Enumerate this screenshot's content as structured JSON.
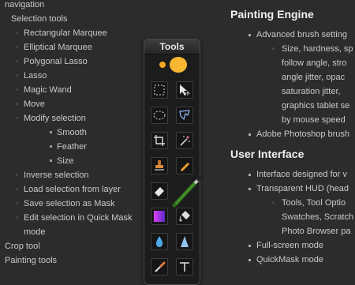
{
  "left_outline": [
    {
      "label": "navigation",
      "level": 0
    },
    {
      "label": "Selection tools",
      "level": 1
    },
    {
      "label": "Rectangular Marquee",
      "level": 2
    },
    {
      "label": "Elliptical Marquee",
      "level": 2
    },
    {
      "label": "Polygonal Lasso",
      "level": 2
    },
    {
      "label": "Lasso",
      "level": 2
    },
    {
      "label": "Magic Wand",
      "level": 2
    },
    {
      "label": "Move",
      "level": 2
    },
    {
      "label": "Modify selection",
      "level": 2
    },
    {
      "label": "Smooth",
      "level": 3
    },
    {
      "label": "Feather",
      "level": 3
    },
    {
      "label": "Size",
      "level": 3
    },
    {
      "label": "Inverse selection",
      "level": 2
    },
    {
      "label": "Load selection from layer",
      "level": 2
    },
    {
      "label": "Save selection as Mask",
      "level": 2
    },
    {
      "label": "Edit selection in Quick Mask mode",
      "level": 2
    },
    {
      "label": "Crop tool",
      "level": 0
    },
    {
      "label": "Painting tools",
      "level": 0
    }
  ],
  "right": {
    "heading1": "Painting Engine",
    "b1_a": "Advanced brush setting",
    "b2_a": "Size, hardness, sp",
    "b2_a_lines": [
      "follow angle, stro",
      "angle jitter, opac",
      "saturation jitter,",
      "graphics tablet se",
      "by mouse speed"
    ],
    "b1_b": "Adobe Photoshop brush",
    "heading2": "User Interface",
    "b1_c": "Interface designed for v",
    "b1_d": "Transparent HUD (head",
    "b2_b": "Tools, Tool Optio",
    "b2_b_lines": [
      "Swatches, Scratch",
      "Photo Browser pa"
    ],
    "b1_e": "Full-screen mode",
    "b1_f": "QuickMask mode"
  },
  "tools_panel": {
    "title": "Tools",
    "tools": [
      {
        "icon": "rectangular-marquee-icon"
      },
      {
        "icon": "move-icon"
      },
      {
        "icon": "elliptical-marquee-icon"
      },
      {
        "icon": "lasso-icon"
      },
      {
        "icon": "crop-icon"
      },
      {
        "icon": "magic-wand-icon"
      },
      {
        "icon": "stamp-icon"
      },
      {
        "icon": "pencil-icon"
      },
      {
        "icon": "eraser-icon"
      },
      {
        "icon": "brush-icon"
      },
      {
        "icon": "gradient-icon"
      },
      {
        "icon": "paint-bucket-icon"
      },
      {
        "icon": "blur-drop-icon"
      },
      {
        "icon": "sharpen-icon"
      },
      {
        "icon": "eyedropper-icon"
      },
      {
        "icon": "text-icon"
      }
    ],
    "colors": {
      "primary": "#f5a623",
      "secondary": "#f7b733"
    }
  }
}
